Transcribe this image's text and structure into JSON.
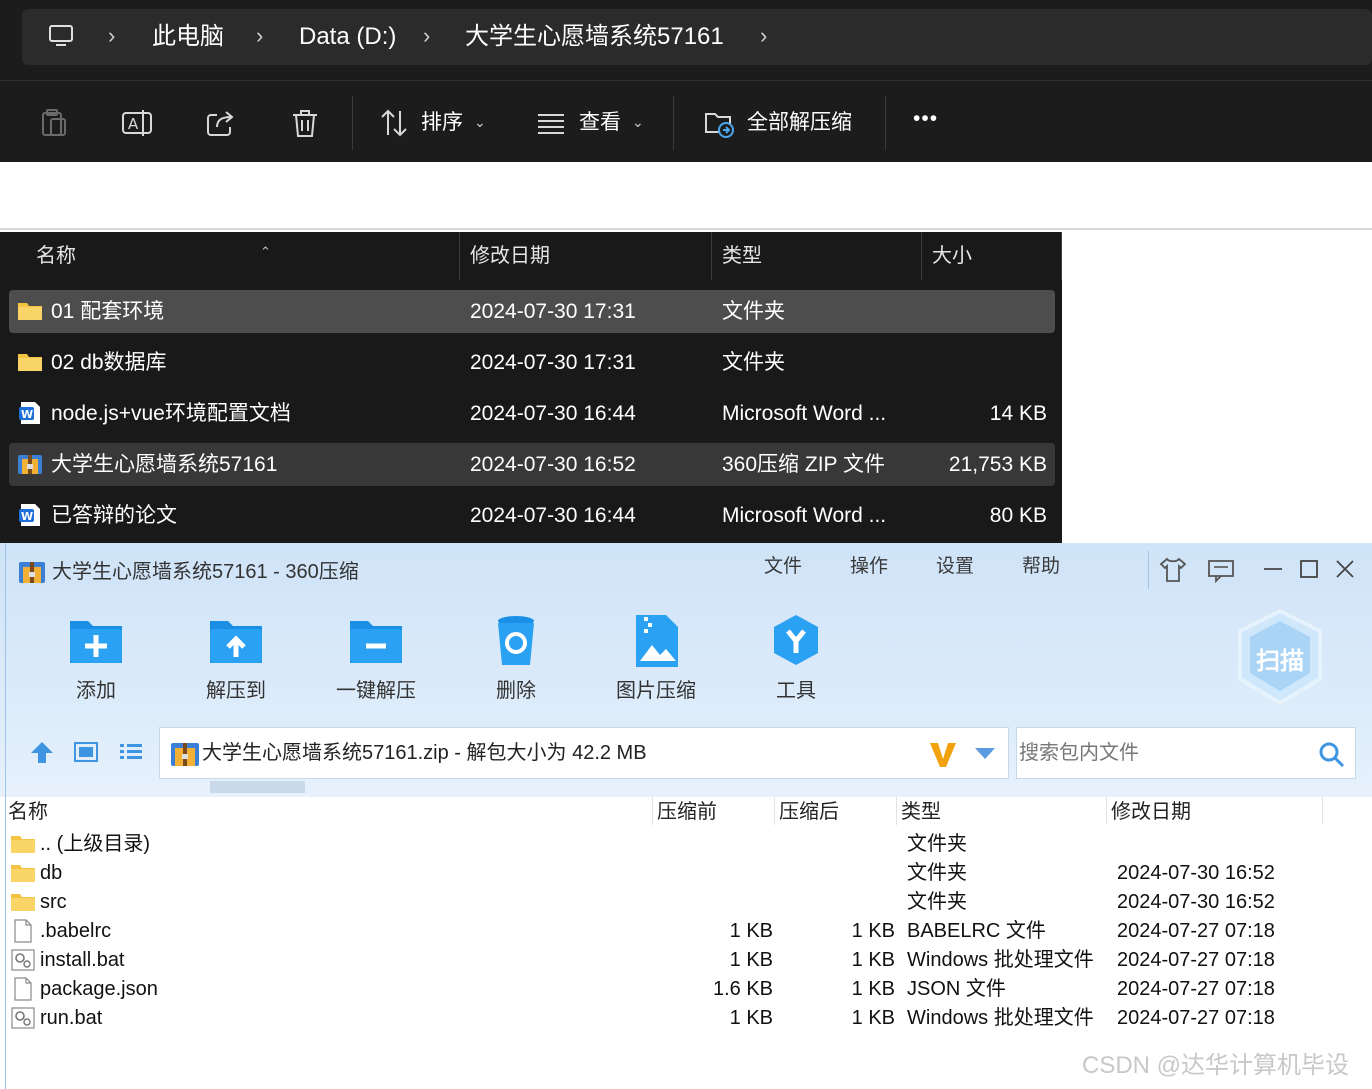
{
  "explorer": {
    "breadcrumb": [
      "此电脑",
      "Data (D:)",
      "大学生心愿墙系统57161"
    ],
    "commands": {
      "sort_label": "排序",
      "view_label": "查看",
      "extract_all_label": "全部解压缩",
      "more_label": "•••"
    },
    "columns": [
      "名称",
      "修改日期",
      "类型",
      "大小"
    ],
    "files": [
      {
        "name": "01 配套环境",
        "date": "2024-07-30 17:31",
        "type": "文件夹",
        "size": "",
        "icon": "folder-icon"
      },
      {
        "name": "02 db数据库",
        "date": "2024-07-30 17:31",
        "type": "文件夹",
        "size": "",
        "icon": "folder-icon"
      },
      {
        "name": "node.js+vue环境配置文档",
        "date": "2024-07-30 16:44",
        "type": "Microsoft Word ...",
        "size": "14 KB",
        "icon": "word-doc-icon"
      },
      {
        "name": "大学生心愿墙系统57161",
        "date": "2024-07-30 16:52",
        "type": "360压缩 ZIP 文件",
        "size": "21,753 KB",
        "icon": "zip-archive-icon"
      },
      {
        "name": "已答辩的论文",
        "date": "2024-07-30 16:44",
        "type": "Microsoft Word ...",
        "size": "80 KB",
        "icon": "word-doc-icon"
      }
    ]
  },
  "zip360": {
    "title": "大学生心愿墙系统57161 - 360压缩",
    "menu": [
      "文件",
      "操作",
      "设置",
      "帮助"
    ],
    "toolbar": [
      "添加",
      "解压到",
      "一键解压",
      "删除",
      "图片压缩",
      "工具"
    ],
    "scan_label": "扫描",
    "path": "大学生心愿墙系统57161.zip - 解包大小为 42.2 MB",
    "search_placeholder": "搜索包内文件",
    "columns": [
      "名称",
      "压缩前",
      "压缩后",
      "类型",
      "修改日期"
    ],
    "entries": [
      {
        "name": ".. (上级目录)",
        "before": "",
        "after": "",
        "type": "文件夹",
        "date": "",
        "icon": "folder-icon"
      },
      {
        "name": "db",
        "before": "",
        "after": "",
        "type": "文件夹",
        "date": "2024-07-30 16:52",
        "icon": "folder-icon"
      },
      {
        "name": "src",
        "before": "",
        "after": "",
        "type": "文件夹",
        "date": "2024-07-30 16:52",
        "icon": "folder-icon"
      },
      {
        "name": ".babelrc",
        "before": "1 KB",
        "after": "1 KB",
        "type": "BABELRC 文件",
        "date": "2024-07-27 07:18",
        "icon": "blank-file-icon"
      },
      {
        "name": "install.bat",
        "before": "1 KB",
        "after": "1 KB",
        "type": "Windows 批处理文件",
        "date": "2024-07-27 07:18",
        "icon": "batch-file-icon"
      },
      {
        "name": "package.json",
        "before": "1.6 KB",
        "after": "1 KB",
        "type": "JSON 文件",
        "date": "2024-07-27 07:18",
        "icon": "blank-file-icon"
      },
      {
        "name": "run.bat",
        "before": "1 KB",
        "after": "1 KB",
        "type": "Windows 批处理文件",
        "date": "2024-07-27 07:18",
        "icon": "batch-file-icon"
      }
    ]
  },
  "watermark": "CSDN @达华计算机毕设",
  "colors": {
    "explorer_bg": "#1c1c1c",
    "selected_row": "#4d4d4d",
    "accent_blue": "#1e8fe0",
    "folder_yellow": "#f5c342"
  }
}
